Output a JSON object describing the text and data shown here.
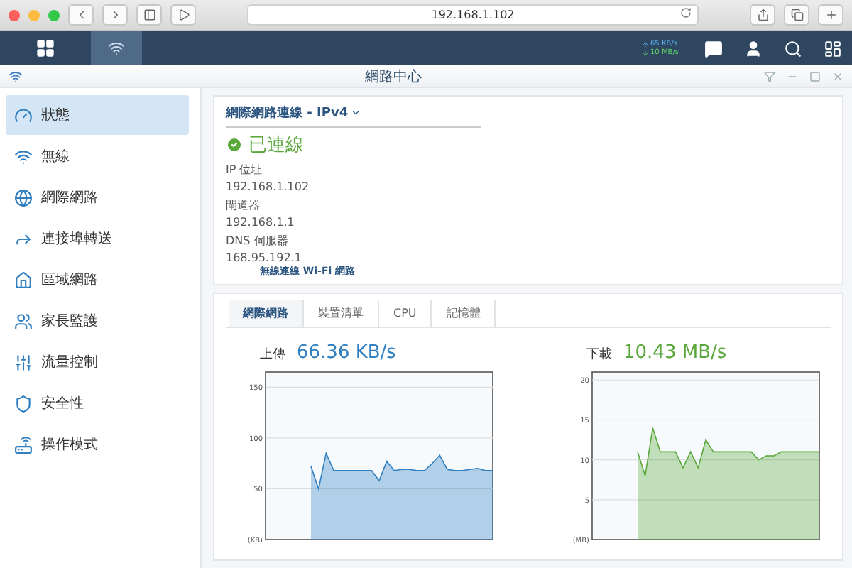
{
  "browser": {
    "url": "192.168.1.102"
  },
  "taskbar": {
    "upload_speed": "65 KB/s",
    "download_speed": "10 MB/s"
  },
  "window": {
    "title": "網路中心"
  },
  "sidebar": {
    "items": [
      {
        "label": "狀態",
        "selected": true
      },
      {
        "label": "無線",
        "selected": false
      },
      {
        "label": "網際網路",
        "selected": false
      },
      {
        "label": "連接埠轉送",
        "selected": false
      },
      {
        "label": "區域網路",
        "selected": false
      },
      {
        "label": "家長監護",
        "selected": false
      },
      {
        "label": "流量控制",
        "selected": false
      },
      {
        "label": "安全性",
        "selected": false
      },
      {
        "label": "操作模式",
        "selected": false
      }
    ]
  },
  "connection": {
    "title": "網際網路連線 - IPv4",
    "status": "已連線",
    "fields": [
      {
        "label": "IP 位址",
        "value": "192.168.1.102"
      },
      {
        "label": "閘道器",
        "value": "192.168.1.1"
      },
      {
        "label": "DNS 伺服器",
        "value": "168.95.192.1"
      }
    ],
    "next_section": "無線連線 Wi-Fi 網路"
  },
  "monitor": {
    "tabs": [
      {
        "label": "網際網路",
        "selected": true
      },
      {
        "label": "裝置清單",
        "selected": false
      },
      {
        "label": "CPU",
        "selected": false
      },
      {
        "label": "記憶體",
        "selected": false
      }
    ],
    "charts": [
      {
        "reading": "66.36 KB/s",
        "chart_data": {
          "type": "area",
          "ylabel": "(KB)",
          "ylim": [
            0,
            165
          ],
          "yticks": [
            50,
            100,
            150
          ],
          "grid": true,
          "series": [
            {
              "name": "上傳",
              "color": "#2f7fc1",
              "values": [
                null,
                null,
                null,
                null,
                null,
                null,
                72,
                50,
                85,
                68,
                68,
                68,
                68,
                68,
                68,
                58,
                77,
                68,
                69,
                69,
                68,
                68,
                75,
                83,
                69,
                68,
                68,
                69,
                70,
                68,
                68
              ]
            }
          ]
        }
      },
      {
        "reading": "10.43 MB/s",
        "chart_data": {
          "type": "area",
          "ylabel": "(MB)",
          "ylim": [
            0,
            21
          ],
          "yticks": [
            5,
            10,
            15,
            20
          ],
          "grid": true,
          "series": [
            {
              "name": "下載",
              "color": "#5aa83c",
              "values": [
                null,
                null,
                null,
                null,
                null,
                null,
                11,
                8,
                14,
                11,
                11,
                11,
                9,
                11,
                9,
                12.5,
                11,
                11,
                11,
                11,
                11,
                11,
                10,
                10.5,
                10.5,
                11,
                11,
                11,
                11,
                11,
                11
              ]
            }
          ]
        }
      }
    ]
  }
}
